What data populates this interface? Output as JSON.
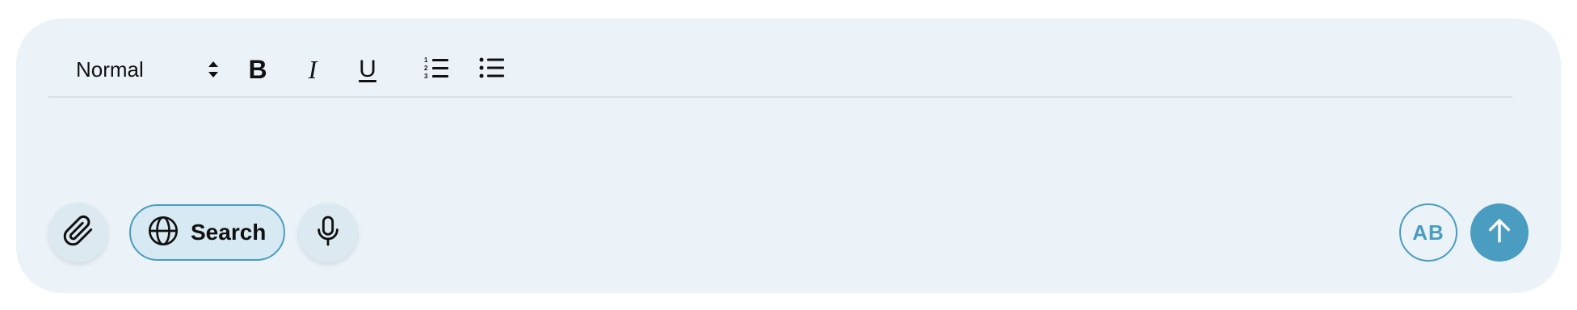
{
  "toolbar": {
    "text_style": {
      "selected": "Normal",
      "icon": "sort-updown-icon"
    },
    "bold": {
      "glyph": "B",
      "icon": "bold-icon"
    },
    "italic": {
      "glyph": "I",
      "icon": "italic-icon"
    },
    "underline": {
      "glyph": "U",
      "icon": "underline-icon"
    },
    "ordered_list": {
      "icon": "ordered-list-icon"
    },
    "bullet_list": {
      "icon": "bullet-list-icon"
    }
  },
  "editor": {
    "content": ""
  },
  "actions": {
    "attach": {
      "icon": "paperclip-icon"
    },
    "search": {
      "label": "Search",
      "icon": "globe-icon"
    },
    "mic": {
      "icon": "microphone-icon"
    },
    "ab": {
      "label": "AB"
    },
    "send": {
      "icon": "arrow-up-icon"
    }
  },
  "colors": {
    "panel_bg": "#ebf3f9",
    "accent": "#4a9dc1",
    "search_bg": "#d7e9f2",
    "circle_btn_bg": "#dce9f0"
  }
}
